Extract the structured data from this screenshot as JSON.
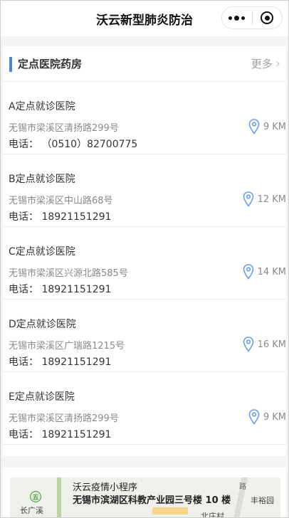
{
  "navbar": {
    "title": "沃云新型肺炎防治",
    "more_icon": "more-dots-icon",
    "close_icon": "target-circle-icon"
  },
  "section": {
    "title": "定点医院药房",
    "more_label": "更多",
    "chevron": "›"
  },
  "hospitals": [
    {
      "name": "A定点就诊医院",
      "address": "无锡市梁溪区清扬路299号",
      "phone": "电话： （0510）82700775",
      "distance": "9 KM"
    },
    {
      "name": "B定点就诊医院",
      "address": "无锡市梁溪区中山路68号",
      "phone": "电话： 18921151291",
      "distance": "12 KM"
    },
    {
      "name": "C定点就诊医院",
      "address": "无锡市梁溪区兴源北路585号",
      "phone": "电话： 18921151291",
      "distance": "14 KM"
    },
    {
      "name": "D定点就诊医院",
      "address": "无锡市梁溪区广瑞路1215号",
      "phone": "电话： 18921151291",
      "distance": "16 KM"
    },
    {
      "name": "E定点就诊医院",
      "address": "无锡市梁溪区清扬路299号",
      "phone": "电话： 18921151291",
      "distance": "9 KM"
    }
  ],
  "map": {
    "place_name": "沃云疫情小程序",
    "place_address": "无锡市滨湖区科教产业园三号楼 10 楼",
    "poi_badge": "五",
    "label_left": "长广溪",
    "label_right": "丰裕园",
    "label_bottom": "北庄村",
    "label_road": "路"
  },
  "colors": {
    "accent": "#4a86e8",
    "pin": "#6a9fe6"
  }
}
